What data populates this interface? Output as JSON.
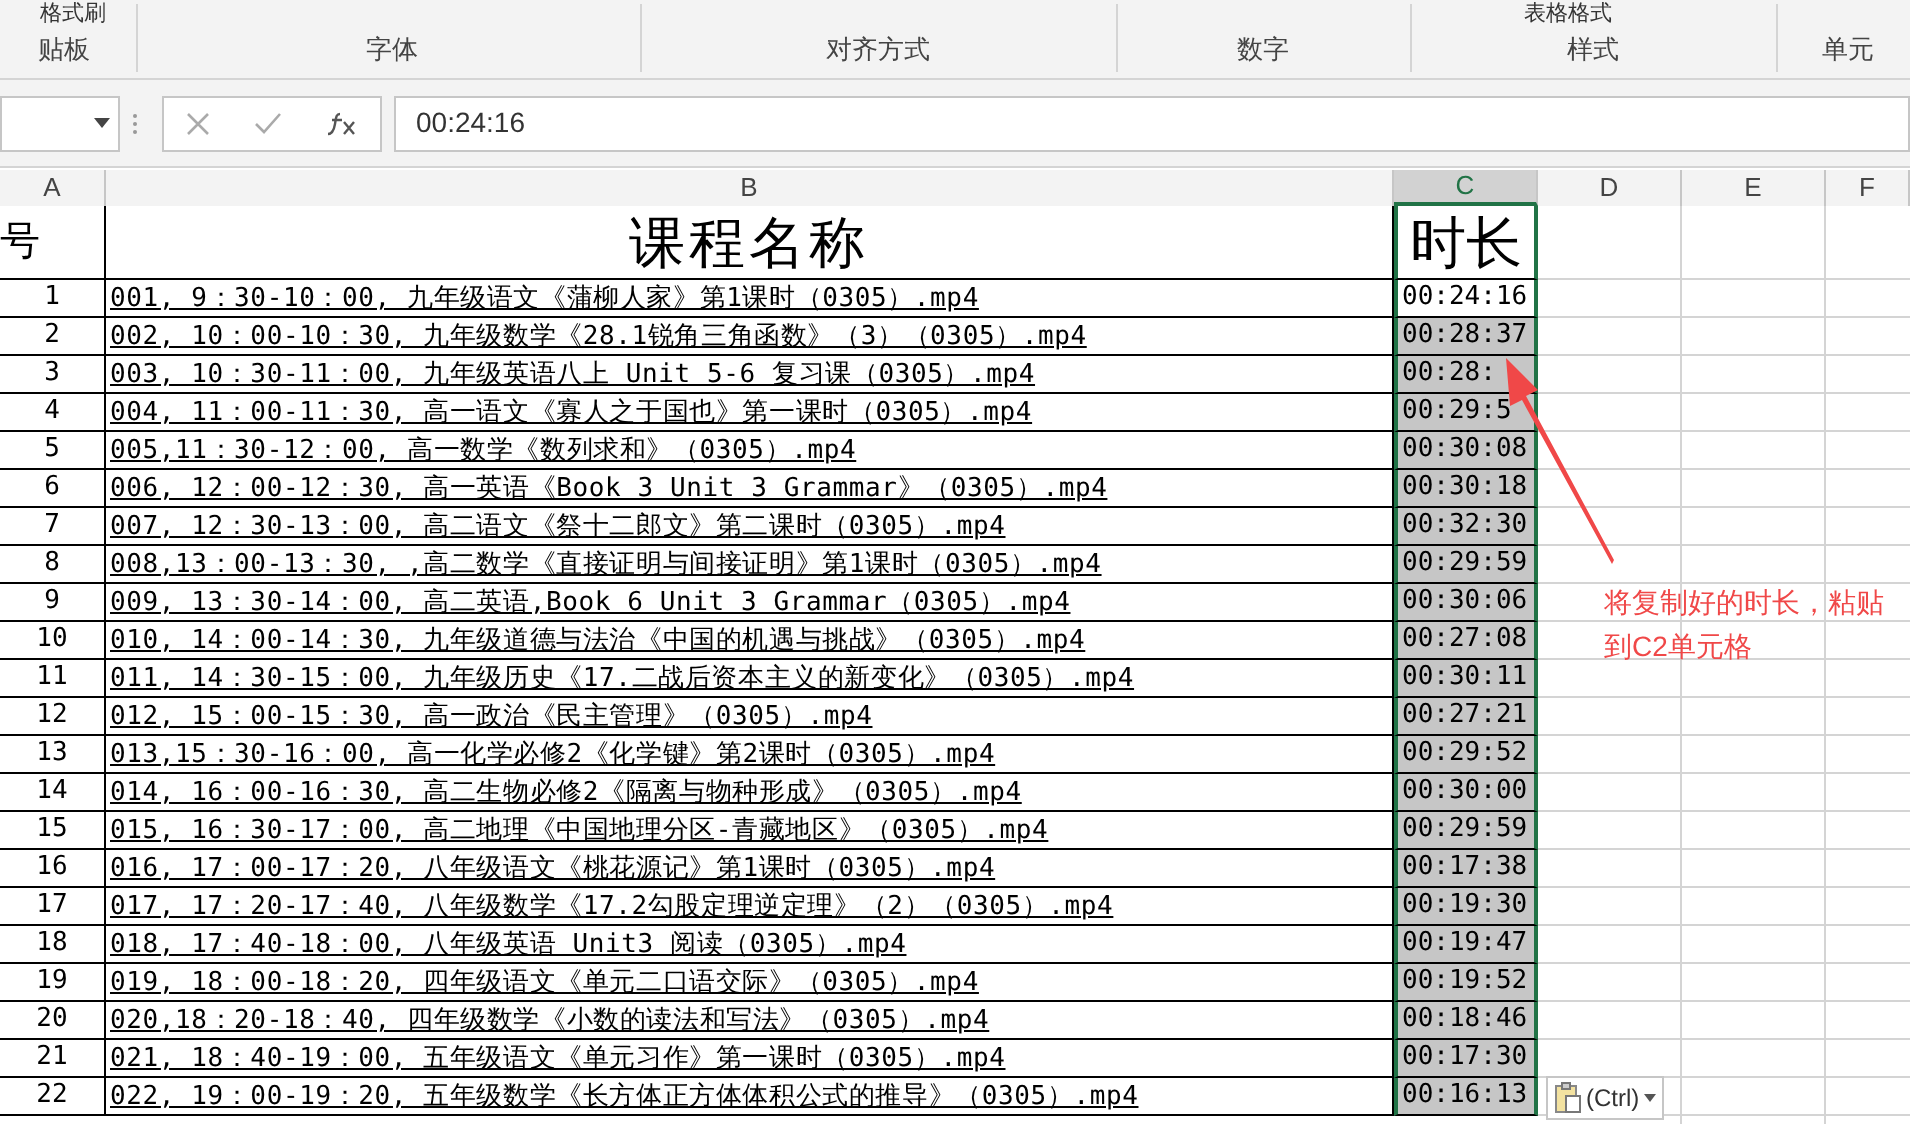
{
  "ribbon": {
    "top_items": [
      "格式刷",
      "表格格式"
    ],
    "groups": [
      "贴板",
      "字体",
      "对齐方式",
      "数字",
      "样式",
      "单元"
    ]
  },
  "formula_bar": {
    "value": "00:24:16"
  },
  "columns": [
    {
      "label": "A",
      "selected": false
    },
    {
      "label": "B",
      "selected": false
    },
    {
      "label": "C",
      "selected": true
    },
    {
      "label": "D",
      "selected": false
    },
    {
      "label": "E",
      "selected": false
    },
    {
      "label": "F",
      "selected": false
    }
  ],
  "header_row": {
    "a": "号",
    "b": "课程名称",
    "c": "时长"
  },
  "rows": [
    {
      "no": "1",
      "name": "001, 9：30-10：00, 九年级语文《蒲柳人家》第1课时（0305）.mp4",
      "duration": "00:24:16",
      "active": true
    },
    {
      "no": "2",
      "name": "002, 10：00-10：30, 九年级数学《28.1锐角三角函数》（3）（0305）.mp4",
      "duration": "00:28:37",
      "active": false
    },
    {
      "no": "3",
      "name": "003, 10：30-11：00, 九年级英语八上 Unit 5-6  复习课（0305）.mp4",
      "duration": "00:28:",
      "active": false
    },
    {
      "no": "4",
      "name": "004, 11：00-11：30, 高一语文《寡人之于国也》第一课时（0305）.mp4",
      "duration": "00:29:5",
      "active": false
    },
    {
      "no": "5",
      "name": "005,11：30-12：00, 高一数学《数列求和》（0305）.mp4",
      "duration": "00:30:08",
      "active": false
    },
    {
      "no": "6",
      "name": "006, 12：00-12：30, 高一英语《Book 3 Unit 3 Grammar》（0305）.mp4",
      "duration": "00:30:18",
      "active": false
    },
    {
      "no": "7",
      "name": "007, 12：30-13：00, 高二语文《祭十二郎文》第二课时（0305）.mp4",
      "duration": "00:32:30",
      "active": false
    },
    {
      "no": "8",
      "name": "008,13：00-13：30, ,高二数学《直接证明与间接证明》第1课时（0305）.mp4",
      "duration": "00:29:59",
      "active": false
    },
    {
      "no": "9",
      "name": "009, 13：30-14：00, 高二英语,Book 6 Unit 3 Grammar（0305）.mp4",
      "duration": "00:30:06",
      "active": false
    },
    {
      "no": "10",
      "name": "010, 14：00-14：30, 九年级道德与法治《中国的机遇与挑战》（0305）.mp4",
      "duration": "00:27:08",
      "active": false
    },
    {
      "no": "11",
      "name": "011, 14：30-15：00,  九年级历史《17.二战后资本主义的新变化》（0305）.mp4",
      "duration": "00:30:11",
      "active": false
    },
    {
      "no": "12",
      "name": "012, 15：00-15：30, 高一政治《民主管理》（0305）.mp4",
      "duration": "00:27:21",
      "active": false
    },
    {
      "no": "13",
      "name": "013,15：30-16：00, 高一化学必修2《化学键》第2课时（0305）.mp4",
      "duration": "00:29:52",
      "active": false
    },
    {
      "no": "14",
      "name": "014, 16：00-16：30, 高二生物必修2《隔离与物种形成》（0305）.mp4",
      "duration": "00:30:00",
      "active": false
    },
    {
      "no": "15",
      "name": "015, 16：30-17：00, 高二地理《中国地理分区-青藏地区》（0305）.mp4",
      "duration": "00:29:59",
      "active": false
    },
    {
      "no": "16",
      "name": "016, 17：00-17：20, 八年级语文《桃花源记》第1课时（0305）.mp4",
      "duration": "00:17:38",
      "active": false
    },
    {
      "no": "17",
      "name": "017, 17：20-17：40, 八年级数学《17.2勾股定理逆定理》（2）（0305）.mp4",
      "duration": "00:19:30",
      "active": false
    },
    {
      "no": "18",
      "name": "018, 17：40-18：00, 八年级英语 Unit3 阅读（0305）.mp4",
      "duration": "00:19:47",
      "active": false
    },
    {
      "no": "19",
      "name": "019, 18：00-18：20, 四年级语文《单元二口语交际》（0305）.mp4",
      "duration": "00:19:52",
      "active": false
    },
    {
      "no": "20",
      "name": "020,18：20-18：40, 四年级数学《小数的读法和写法》（0305）.mp4",
      "duration": "00:18:46",
      "active": false
    },
    {
      "no": "21",
      "name": "021, 18：40-19：00, 五年级语文《单元习作》第一课时（0305）.mp4",
      "duration": "00:17:30",
      "active": false
    },
    {
      "no": "22",
      "name": "022, 19：00-19：20, 五年级数学《长方体正方体体积公式的推导》（0305）.mp4",
      "duration": "00:16:13",
      "active": false
    }
  ],
  "annotation": "将复制好的时长，粘贴到C2单元格",
  "paste_options": "(Ctrl)"
}
